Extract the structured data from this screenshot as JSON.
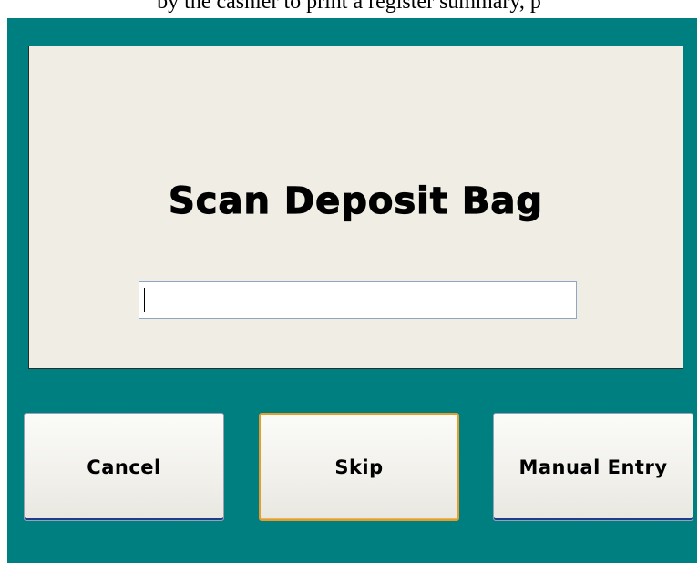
{
  "top_text": "by the cashier to print a register summary, p",
  "prompt": {
    "title": "Scan Deposit Bag",
    "input_value": ""
  },
  "buttons": {
    "cancel": "Cancel",
    "skip": "Skip",
    "manual_entry": "Manual Entry"
  },
  "colors": {
    "background": "#007f80",
    "panel": "#f0eee4",
    "focus_border": "#e59e2c",
    "button_bottom_border": "#1f3c8a"
  }
}
